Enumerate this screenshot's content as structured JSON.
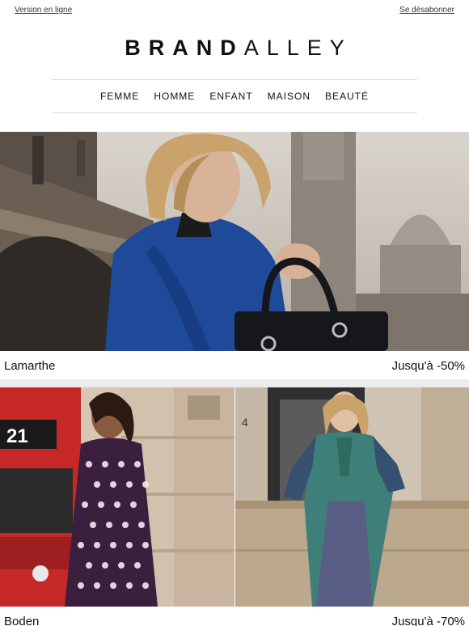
{
  "header": {
    "online_version": "Version en ligne",
    "unsubscribe": "Se désabonner",
    "logo_bold": "BRAND",
    "logo_light": "ALLEY"
  },
  "nav": {
    "items": [
      {
        "label": "FEMME"
      },
      {
        "label": "HOMME"
      },
      {
        "label": "ENFANT"
      },
      {
        "label": "MAISON"
      },
      {
        "label": "BEAUTÉ"
      }
    ]
  },
  "promos": [
    {
      "brand": "Lamarthe",
      "discount": "Jusqu'à -50%"
    },
    {
      "brand": "Boden",
      "discount": "Jusqu'à -70%"
    }
  ],
  "bus": {
    "route_number": "21"
  },
  "door": {
    "house_number": "4"
  },
  "colors": {
    "text": "#111111",
    "divider": "#d9d9d9",
    "section_gap": "#ececec",
    "jacket_blue": "#1f4a9a",
    "bus_red": "#c62828"
  }
}
